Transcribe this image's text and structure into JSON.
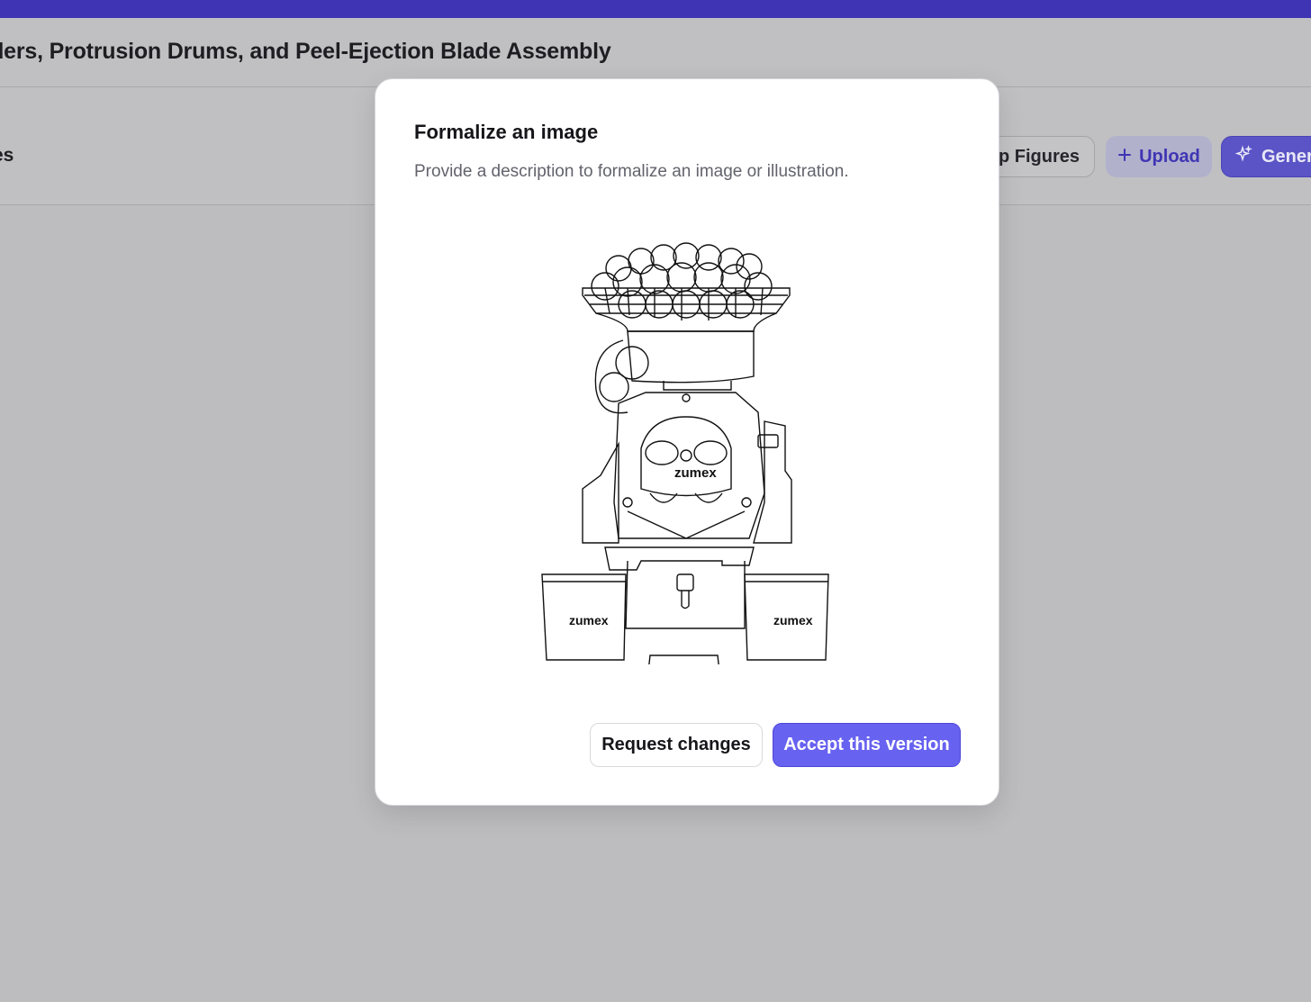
{
  "header": {
    "document_title": "nders, Protrusion Drums, and Peel-Ejection Blade Assembly"
  },
  "toolbar": {
    "left_label": "es",
    "setup_figures_label": "up Figures",
    "upload_label": "Upload",
    "upload_icon": "plus-icon",
    "generate_label": "Gener",
    "generate_icon": "sparkle-icon"
  },
  "modal": {
    "title": "Formalize an image",
    "description": "Provide a description to formalize an image or illustration.",
    "illustration": {
      "subject": "line drawing of a juicing machine",
      "logo_text": "zumex"
    },
    "request_changes_label": "Request changes",
    "accept_label": "Accept this version"
  },
  "colors": {
    "accent": "#3f35b4",
    "primary_button": "#6762f0",
    "overlay": "#bdbdc0"
  }
}
